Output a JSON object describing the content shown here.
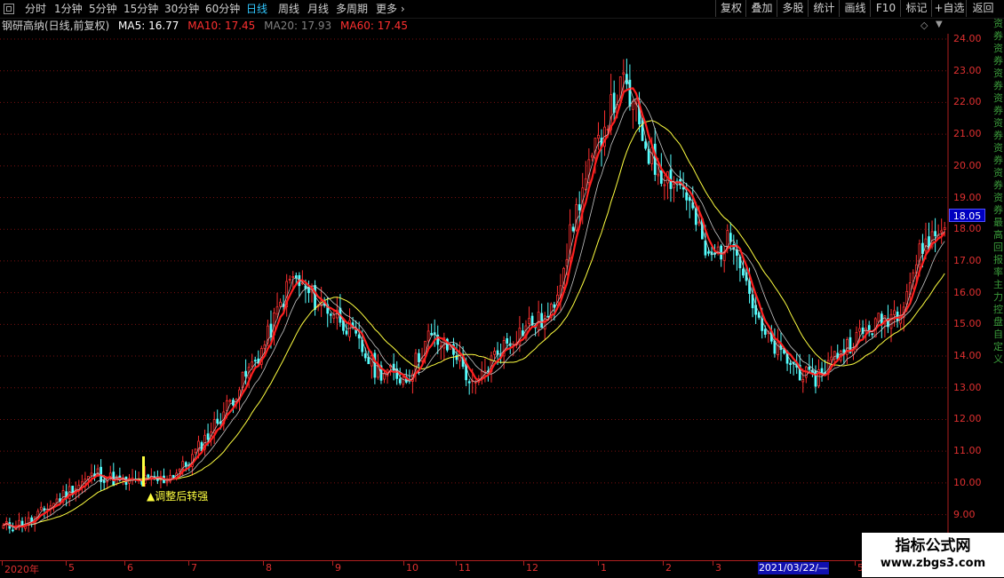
{
  "toolbar": {
    "periods": [
      "分时",
      "1分钟",
      "5分钟",
      "15分钟",
      "30分钟",
      "60分钟",
      "日线",
      "周线",
      "月线",
      "多周期",
      "更多"
    ],
    "active_period": "日线",
    "right_buttons": [
      "复权",
      "叠加",
      "多股",
      "统计",
      "画线",
      "F10",
      "标记",
      "+自选",
      "返回"
    ]
  },
  "infobar": {
    "stock_title": "钢研高纳(日线,前复权)",
    "ma5_label": "MA5: 16.77",
    "ma10_label": "MA10: 17.45",
    "ma20_label": "MA20: 17.93",
    "ma60_label": "MA60: 17.45"
  },
  "colors": {
    "up": "#ff3030",
    "down": "#54ffff",
    "ma5": "#c8c8c8",
    "ma10": "#ff2020",
    "ma20": "#c8c8c8",
    "ma60": "#ffff40",
    "grid": "#7a1010",
    "axis": "#e03030",
    "signal": "#ffff40"
  },
  "price_axis": {
    "labels": [
      "24.00",
      "23.00",
      "22.00",
      "21.00",
      "20.00",
      "19.00",
      "18.00",
      "17.00",
      "16.00",
      "15.00",
      "14.00",
      "13.00",
      "12.00",
      "11.00",
      "10.00",
      "9.00"
    ],
    "current_price": "18.05"
  },
  "date_axis": {
    "labels": [
      "2020年",
      "5",
      "6",
      "7",
      "8",
      "9",
      "10",
      "11",
      "12",
      "1",
      "2",
      "3",
      "5"
    ],
    "cursor_date": "2021/03/22/—"
  },
  "annotation": {
    "text": "▲调整后转强"
  },
  "side_strip": {
    "text": "资券资券资券资券资券资券资券资券最高回报率主力控盘自定义"
  },
  "watermark": {
    "title": "指标公式网",
    "url": "www.zbgs3.com"
  },
  "chart_data": {
    "type": "candlestick",
    "title": "钢研高纳(日线,前复权)",
    "ylim": [
      8.6,
      24.1
    ],
    "x_periods": [
      "2020-04",
      "2020-05",
      "2020-06",
      "2020-07",
      "2020-08",
      "2020-09",
      "2020-10",
      "2020-11",
      "2020-12",
      "2021-01",
      "2021-02",
      "2021-03",
      "2021-04",
      "2021-05"
    ],
    "close_path": [
      {
        "date": "2020-04-07",
        "close": 8.6
      },
      {
        "date": "2020-04-20",
        "close": 8.8
      },
      {
        "date": "2020-05-06",
        "close": 9.7
      },
      {
        "date": "2020-05-20",
        "close": 10.3
      },
      {
        "date": "2020-06-01",
        "close": 10.0
      },
      {
        "date": "2020-06-20",
        "close": 10.1
      },
      {
        "date": "2020-07-01",
        "close": 10.6
      },
      {
        "date": "2020-07-20",
        "close": 12.5
      },
      {
        "date": "2020-08-05",
        "close": 14.3
      },
      {
        "date": "2020-08-18",
        "close": 16.5
      },
      {
        "date": "2020-08-28",
        "close": 15.8
      },
      {
        "date": "2020-09-10",
        "close": 15.2
      },
      {
        "date": "2020-09-25",
        "close": 13.6
      },
      {
        "date": "2020-10-10",
        "close": 13.3
      },
      {
        "date": "2020-10-20",
        "close": 14.6
      },
      {
        "date": "2020-11-02",
        "close": 14.1
      },
      {
        "date": "2020-11-10",
        "close": 12.9
      },
      {
        "date": "2020-11-20",
        "close": 14.1
      },
      {
        "date": "2020-12-05",
        "close": 15.0
      },
      {
        "date": "2020-12-15",
        "close": 15.2
      },
      {
        "date": "2020-12-28",
        "close": 18.8
      },
      {
        "date": "2021-01-10",
        "close": 21.5
      },
      {
        "date": "2021-01-18",
        "close": 22.6
      },
      {
        "date": "2021-02-01",
        "close": 20.0
      },
      {
        "date": "2021-02-15",
        "close": 19.3
      },
      {
        "date": "2021-02-26",
        "close": 17.0
      },
      {
        "date": "2021-03-10",
        "close": 17.8
      },
      {
        "date": "2021-03-22",
        "close": 14.8
      },
      {
        "date": "2021-04-01",
        "close": 14.0
      },
      {
        "date": "2021-04-15",
        "close": 13.2
      },
      {
        "date": "2021-04-28",
        "close": 14.2
      },
      {
        "date": "2021-05-10",
        "close": 14.8
      },
      {
        "date": "2021-05-25",
        "close": 15.5
      },
      {
        "date": "2021-06-05",
        "close": 17.5
      },
      {
        "date": "2021-06-15",
        "close": 18.05
      }
    ],
    "ma_lines": [
      "MA5",
      "MA10",
      "MA20",
      "MA60"
    ],
    "signal": {
      "text": "▲调整后转强",
      "date": "2020-06-20"
    }
  }
}
